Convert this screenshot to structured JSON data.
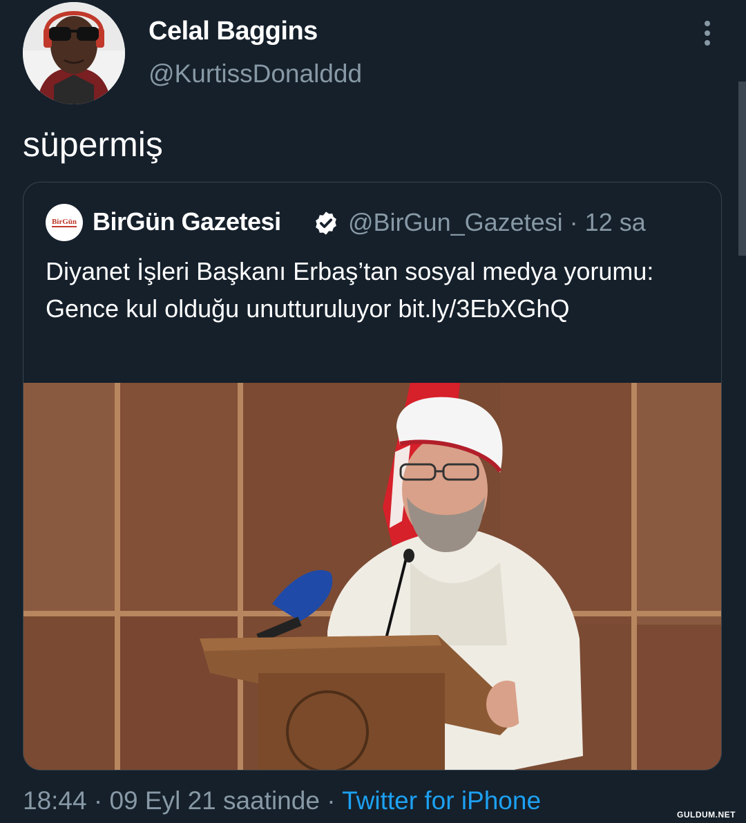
{
  "author": {
    "display_name": "Celal Baggins",
    "handle": "@KurtissDonalddd"
  },
  "tweet": {
    "text": "süpermiş"
  },
  "quoted_tweet": {
    "display_name": "BirGün Gazetesi",
    "handle_time": "@BirGun_Gazetesi · 12 sa",
    "logo_text": "BirGün",
    "text": "Diyanet İşleri Başkanı Erbaş’tan sosyal medya yorumu: Gence kul olduğu unutturuluyor bit.ly/3EbXGhQ"
  },
  "meta": {
    "time_date": "18:44 · 09 Eyl 21 saatinde · ",
    "source": "Twitter for iPhone"
  },
  "watermark": "GULDUM.NET",
  "icons": {
    "more": "more-vertical-icon",
    "verified": "verified-badge-icon"
  },
  "colors": {
    "background": "#15202b",
    "secondary_text": "#8899a6",
    "link": "#1da1f2",
    "border": "#38444d"
  }
}
